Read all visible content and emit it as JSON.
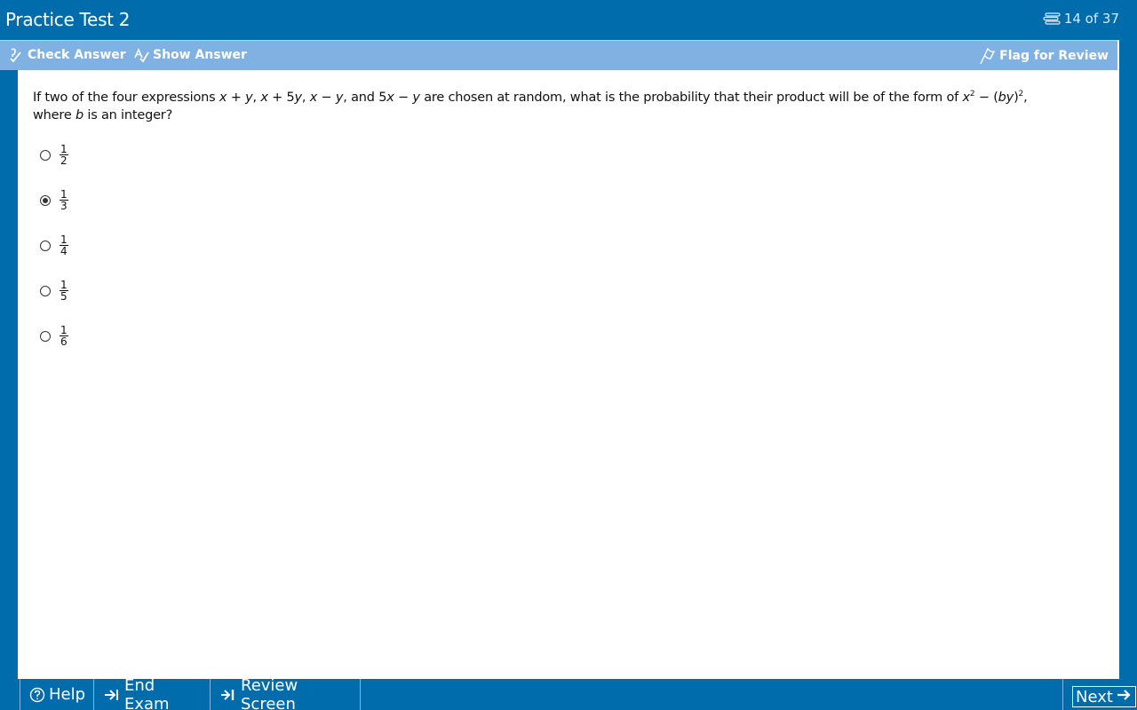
{
  "header": {
    "title": "Practice Test 2",
    "counter": "14 of 37",
    "counter_icon": "list-icon"
  },
  "toolbar": {
    "check_answer": {
      "label": "Check Answer",
      "icon": "check-answer-icon"
    },
    "show_answer": {
      "label": "Show Answer",
      "icon": "show-answer-icon"
    },
    "flag_review": {
      "label": "Flag for Review",
      "icon": "flag-icon"
    }
  },
  "question": {
    "text_line1_html": "If two of the four expressions",
    "text_line2": "where b is an integer?"
  },
  "choices": [
    {
      "numerator": "1",
      "denominator": "2",
      "selected": false
    },
    {
      "numerator": "1",
      "denominator": "3",
      "selected": true
    },
    {
      "numerator": "1",
      "denominator": "4",
      "selected": false
    },
    {
      "numerator": "1",
      "denominator": "5",
      "selected": false
    },
    {
      "numerator": "1",
      "denominator": "6",
      "selected": false
    }
  ],
  "footer": {
    "help": "Help",
    "end_exam": "End Exam",
    "review_screen": "Review Screen",
    "next": "Next"
  },
  "colors": {
    "background": "#006cac",
    "toolbar": "#7fb1e2",
    "content": "#ffffff"
  }
}
